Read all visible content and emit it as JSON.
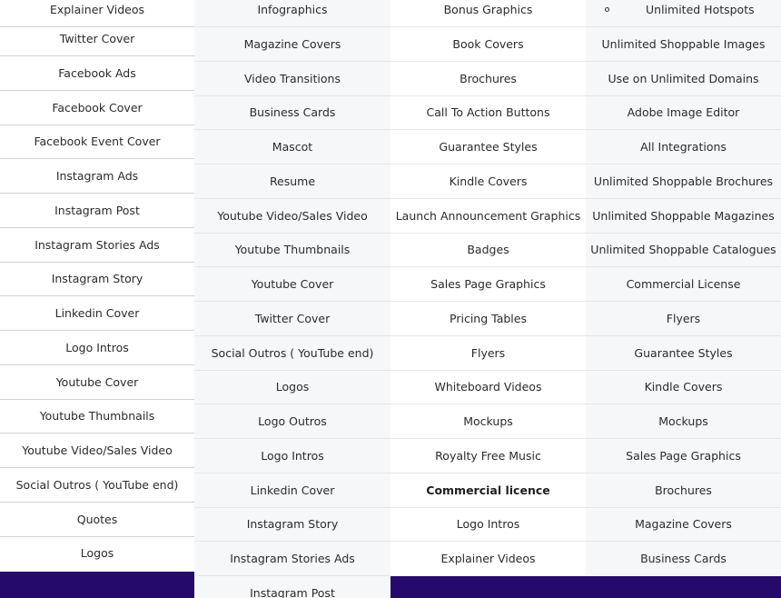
{
  "columns": [
    {
      "key": "a",
      "items": [
        "Explainer Videos",
        "Twitter Cover",
        "Facebook Ads",
        "Facebook Cover",
        "Facebook Event Cover",
        "Instagram Ads",
        "Instagram Post",
        "Instagram Stories Ads",
        "Instagram Story",
        "Linkedin Cover",
        "Logo Intros",
        "Youtube Cover",
        "Youtube Thumbnails",
        "Youtube Video/Sales Video",
        "Social Outros ( YouTube end)",
        "Quotes",
        "Logos"
      ]
    },
    {
      "key": "b",
      "items": [
        "Infographics",
        "Magazine Covers",
        "Video Transitions",
        "Business Cards",
        "Mascot",
        "Resume",
        "Youtube Video/Sales Video",
        "Youtube Thumbnails",
        "Youtube Cover",
        "Twitter Cover",
        "Social Outros ( YouTube end)",
        "Logos",
        "Logo Outros",
        "Logo Intros",
        "Linkedin Cover",
        "Instagram Story",
        "Instagram Stories Ads",
        "Instagram Post"
      ]
    },
    {
      "key": "c",
      "items": [
        "Bonus Graphics",
        "Book Covers",
        "Brochures",
        "Call To Action Buttons",
        "Guarantee Styles",
        "Kindle Covers",
        "Launch Announcement Graphics",
        "Badges",
        "Sales Page Graphics",
        "Pricing Tables",
        "Flyers",
        "Whiteboard Videos",
        "Mockups",
        "Royalty Free Music",
        "Commercial licence",
        "Logo Intros",
        "Explainer Videos"
      ]
    },
    {
      "key": "d",
      "items": [
        "Unlimited Hotspots",
        "Unlimited Shoppable Images",
        "Use on Unlimited Domains",
        "Adobe Image Editor",
        "All Integrations",
        "Unlimited Shoppable Brochures",
        "Unlimited Shoppable Magazines",
        "Unlimited Shoppable Catalogues",
        "Commercial License",
        "Flyers",
        "Guarantee Styles",
        "Kindle Covers",
        "Mockups",
        "Sales Page Graphics",
        "Brochures",
        "Magazine Covers",
        "Business Cards"
      ]
    }
  ],
  "colors": {
    "accent_bar": "#260a6b",
    "shaded_column": "#f6f7f9",
    "text": "#2b2b2b"
  }
}
